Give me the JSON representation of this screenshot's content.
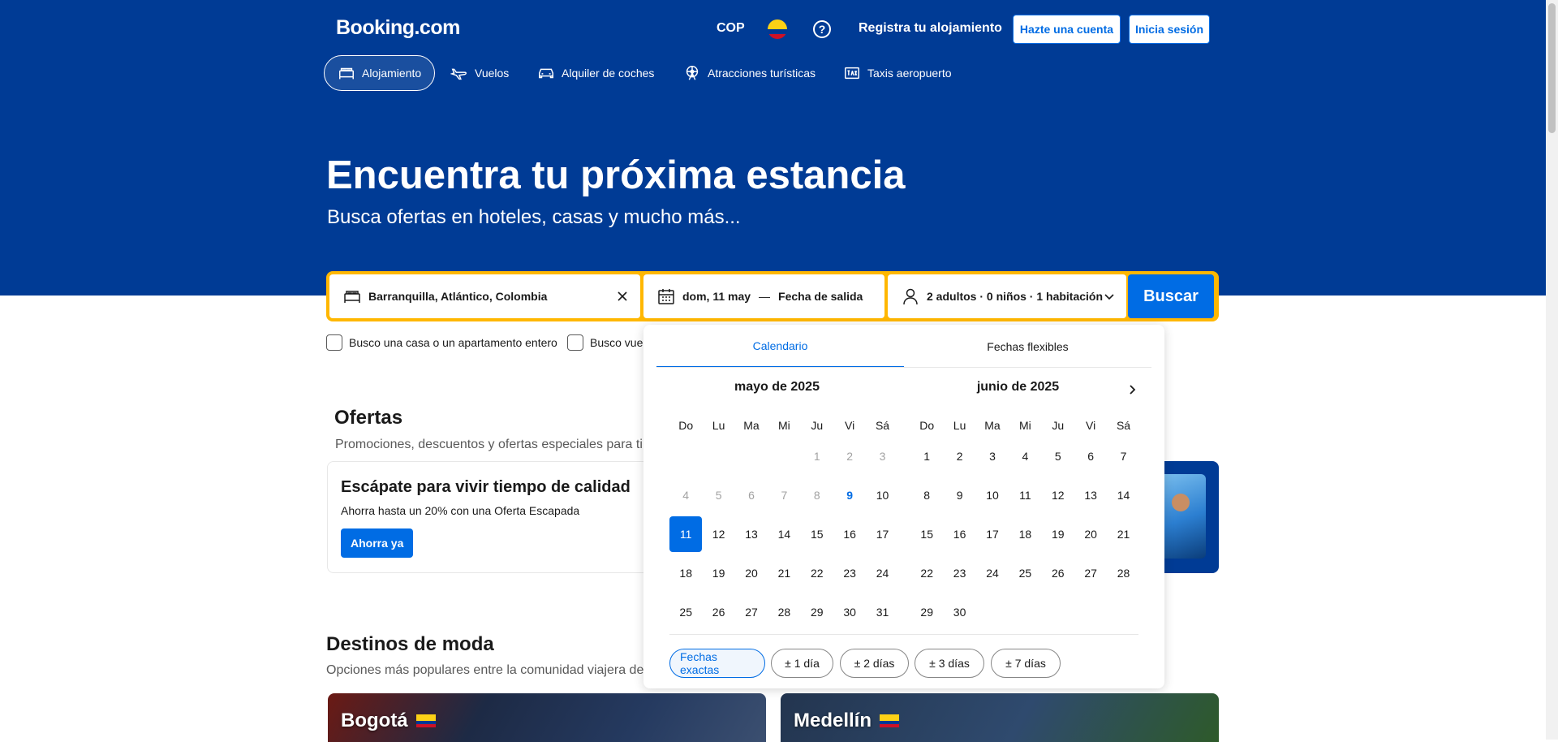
{
  "header": {
    "logo": "Booking.com",
    "currency": "COP",
    "help": "?",
    "register": "Registra tu alojamiento",
    "signup": "Hazte una cuenta",
    "login": "Inicia sesión"
  },
  "nav": [
    "Alojamiento",
    "Vuelos",
    "Alquiler de coches",
    "Atracciones turísticas",
    "Taxis aeropuerto"
  ],
  "hero": {
    "title": "Encuentra tu próxima estancia",
    "subtitle": "Busca ofertas en hoteles, casas y mucho más..."
  },
  "search": {
    "destination": "Barranquilla, Atlántico, Colombia",
    "checkin": "dom, 11 may",
    "dash": "—",
    "checkout": "Fecha de salida",
    "guests": "2 adultos · 0 niños · 1 habitación",
    "button": "Buscar"
  },
  "checkboxes": [
    "Busco una casa o un apartamento entero",
    "Busco vuel"
  ],
  "offers": {
    "title": "Ofertas",
    "subtitle": "Promociones, descuentos y ofertas especiales para ti",
    "card_title": "Escápate para vivir tiempo de calidad",
    "card_text": "Ahorra hasta un 20% con una Oferta Escapada",
    "card_button": "Ahorra ya"
  },
  "trending": {
    "title": "Destinos de moda",
    "subtitle": "Opciones más populares entre la comunidad viajera de",
    "cities": [
      "Bogotá",
      "Medellín"
    ]
  },
  "calendar": {
    "tabs": [
      "Calendario",
      "Fechas flexibles"
    ],
    "weekdays": [
      "Do",
      "Lu",
      "Ma",
      "Mi",
      "Ju",
      "Vi",
      "Sá"
    ],
    "months": [
      {
        "title": "mayo de 2025",
        "offset": 4,
        "days": 31,
        "past_until": 8,
        "today": 9,
        "selected": 11
      },
      {
        "title": "junio de 2025",
        "offset": 0,
        "days": 30,
        "past_until": 0,
        "today": 0,
        "selected": 0
      }
    ],
    "chips": [
      "Fechas exactas",
      "± 1 día",
      "± 2 días",
      "± 3 días",
      "± 7 días"
    ]
  },
  "colors": {
    "brand_blue": "#003b95",
    "action_blue": "#006ce4",
    "search_yellow": "#ffb700"
  }
}
